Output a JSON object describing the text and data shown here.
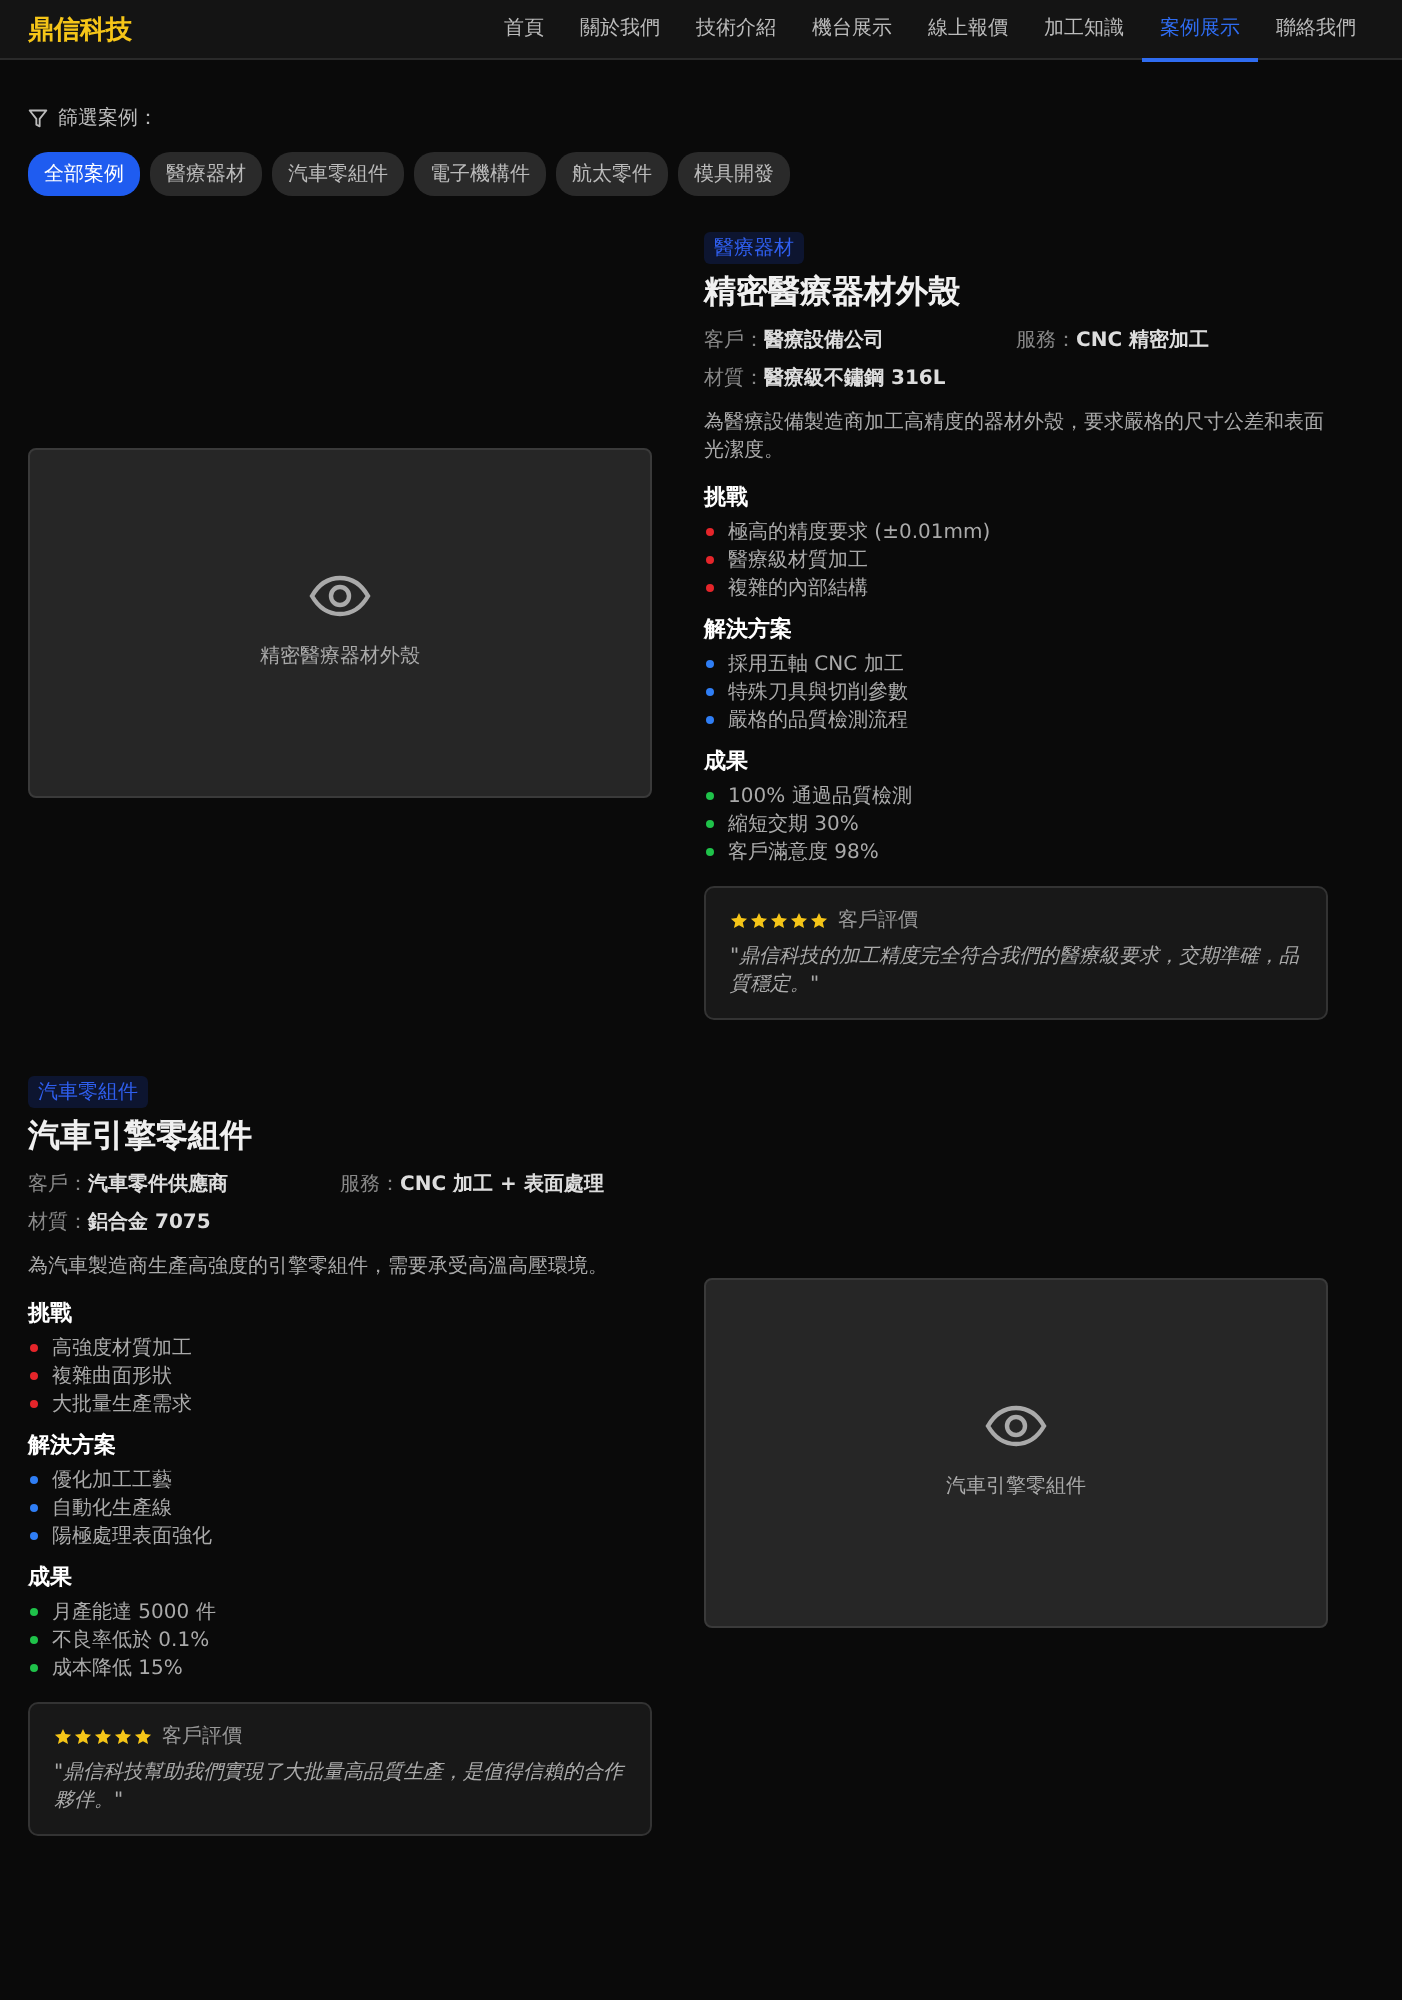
{
  "header": {
    "logo": "鼎信科技",
    "nav": [
      {
        "label": "首頁",
        "selected": false
      },
      {
        "label": "關於我們",
        "selected": false
      },
      {
        "label": "技術介紹",
        "selected": false
      },
      {
        "label": "機台展示",
        "selected": false
      },
      {
        "label": "線上報價",
        "selected": false
      },
      {
        "label": "加工知識",
        "selected": false
      },
      {
        "label": "案例展示",
        "selected": true
      },
      {
        "label": "聯絡我們",
        "selected": false
      }
    ]
  },
  "filter": {
    "label": "篩選案例：",
    "chips": [
      {
        "label": "全部案例",
        "selected": true
      },
      {
        "label": "醫療器材",
        "selected": false
      },
      {
        "label": "汽車零組件",
        "selected": false
      },
      {
        "label": "電子機構件",
        "selected": false
      },
      {
        "label": "航太零件",
        "selected": false
      },
      {
        "label": "模具開發",
        "selected": false
      }
    ]
  },
  "cases": [
    {
      "image_caption": "精密醫療器材外殼",
      "tag": "醫療器材",
      "title": "精密醫療器材外殼",
      "meta": [
        {
          "label": "客戶：",
          "value": "醫療設備公司"
        },
        {
          "label": "服務：",
          "value": "CNC 精密加工"
        },
        {
          "label": "材質：",
          "value": "醫療級不鏽鋼 316L"
        }
      ],
      "description": "為醫療設備製造商加工高精度的器材外殼，要求嚴格的尺寸公差和表面光潔度。",
      "sections": [
        {
          "kind": "challenge",
          "heading": "挑戰",
          "items": [
            "極高的精度要求 (±0.01mm)",
            "醫療級材質加工",
            "複雜的內部結構"
          ]
        },
        {
          "kind": "solution",
          "heading": "解決方案",
          "items": [
            "採用五軸 CNC 加工",
            "特殊刀具與切削參數",
            "嚴格的品質檢測流程"
          ]
        },
        {
          "kind": "result",
          "heading": "成果",
          "items": [
            "100% 通過品質檢測",
            "縮短交期 30%",
            "客戶滿意度 98%"
          ]
        }
      ],
      "review": {
        "stars": 5,
        "label": "客戶評價",
        "quote": "\"鼎信科技的加工精度完全符合我們的醫療級要求，交期準確，品質穩定。\""
      }
    },
    {
      "image_caption": "汽車引擎零組件",
      "tag": "汽車零組件",
      "title": "汽車引擎零組件",
      "meta": [
        {
          "label": "客戶：",
          "value": "汽車零件供應商"
        },
        {
          "label": "服務：",
          "value": "CNC 加工 + 表面處理"
        },
        {
          "label": "材質：",
          "value": "鋁合金 7075"
        }
      ],
      "description": "為汽車製造商生產高強度的引擎零組件，需要承受高溫高壓環境。",
      "sections": [
        {
          "kind": "challenge",
          "heading": "挑戰",
          "items": [
            "高強度材質加工",
            "複雜曲面形狀",
            "大批量生產需求"
          ]
        },
        {
          "kind": "solution",
          "heading": "解決方案",
          "items": [
            "優化加工工藝",
            "自動化生產線",
            "陽極處理表面強化"
          ]
        },
        {
          "kind": "result",
          "heading": "成果",
          "items": [
            "月產能達 5000 件",
            "不良率低於 0.1%",
            "成本降低 15%"
          ]
        }
      ],
      "review": {
        "stars": 5,
        "label": "客戶評價",
        "quote": "\"鼎信科技幫助我們實現了大批量高品質生產，是值得信賴的合作夥伴。\""
      }
    }
  ]
}
